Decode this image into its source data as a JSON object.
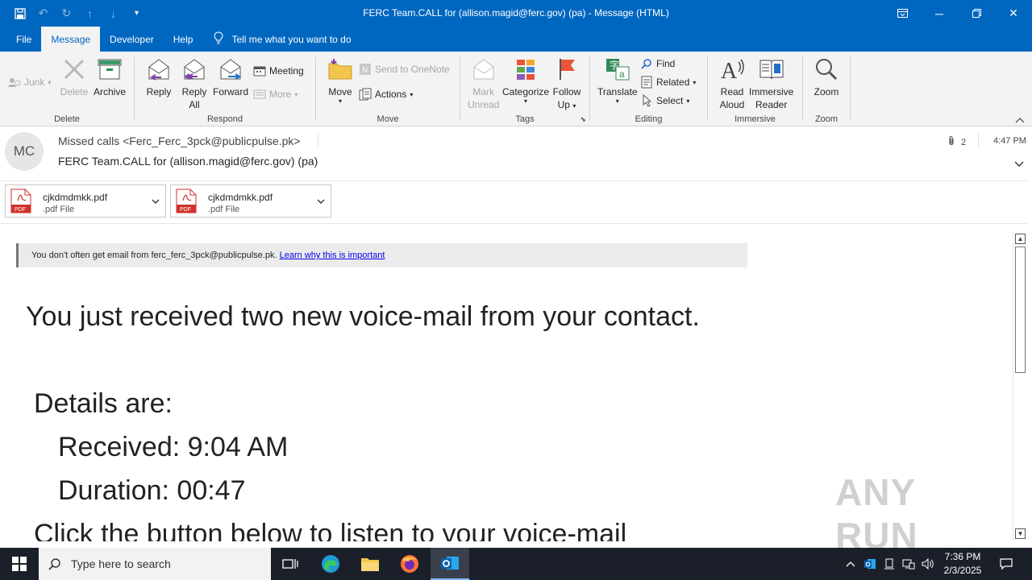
{
  "window": {
    "title": "FERC  Team.CALL  for (allison.magid@ferc.gov) (pa)  -  Message (HTML)"
  },
  "colors": {
    "accent": "#0067c0",
    "taskbar": "#1b1f2a",
    "pdf_red": "#d0312d"
  },
  "tabs": {
    "file": "File",
    "message": "Message",
    "developer": "Developer",
    "help": "Help",
    "tell_me": "Tell me what you want to do"
  },
  "ribbon": {
    "delete_group": {
      "label": "Delete",
      "junk": "Junk",
      "delete": "Delete",
      "archive": "Archive"
    },
    "respond_group": {
      "label": "Respond",
      "reply": "Reply",
      "reply_all_1": "Reply",
      "reply_all_2": "All",
      "forward": "Forward",
      "meeting": "Meeting",
      "more": "More"
    },
    "move_group": {
      "label": "Move",
      "move": "Move",
      "send_to_onenote": "Send to OneNote",
      "actions": "Actions"
    },
    "tags_group": {
      "label": "Tags",
      "mark_unread_1": "Mark",
      "mark_unread_2": "Unread",
      "categorize": "Categorize",
      "follow_up_1": "Follow",
      "follow_up_2": "Up"
    },
    "editing_group": {
      "label": "Editing",
      "translate": "Translate",
      "find": "Find",
      "related": "Related",
      "select": "Select"
    },
    "immersive_group": {
      "label": "Immersive",
      "read_aloud_1": "Read",
      "read_aloud_2": "Aloud",
      "immersive_reader_1": "Immersive",
      "immersive_reader_2": "Reader"
    },
    "zoom_group": {
      "label": "Zoom",
      "zoom": "Zoom"
    }
  },
  "message": {
    "avatar_initials": "MC",
    "from": "Missed calls <Ferc_Ferc_3pck@publicpulse.pk>",
    "subject": "FERC  Team.CALL  for (allison.magid@ferc.gov) (pa)",
    "attachment_count": "2",
    "time": "4:47 PM",
    "attachments": [
      {
        "name": "cjkdmdmkk.pdf",
        "type": ".pdf File"
      },
      {
        "name": "cjkdmdmkk.pdf",
        "type": ".pdf File"
      }
    ]
  },
  "body": {
    "warning_text": "You don't often get email from ferc_ferc_3pck@publicpulse.pk.",
    "warning_link": "Learn why this is important",
    "line1": "You just received two new voice-mail from your contact.",
    "line2": "Details are:",
    "line3": "Received: 9:04 AM",
    "line4": "Duration:  00:47",
    "line5": "Click the button below to listen to your voice-mail"
  },
  "watermark": "ANY RUN",
  "taskbar": {
    "search_placeholder": "Type here to search",
    "time": "7:36 PM",
    "date": "2/3/2025"
  }
}
